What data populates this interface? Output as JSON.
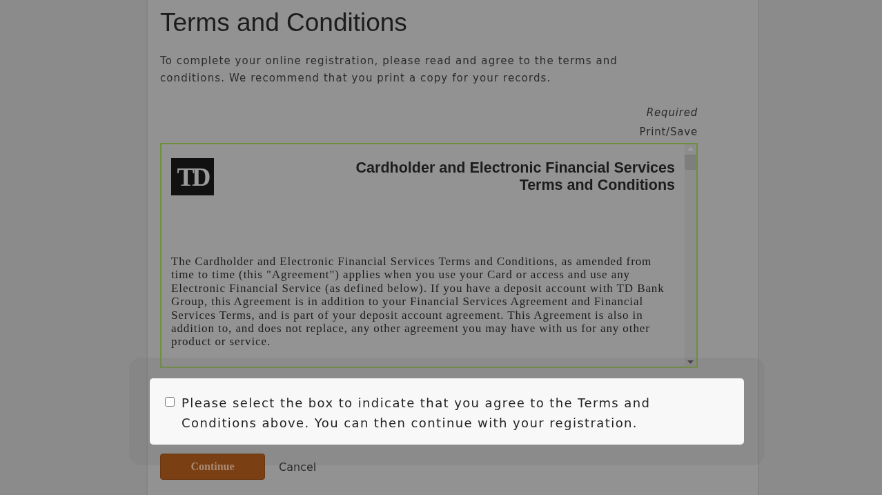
{
  "page": {
    "title": "Terms and Conditions",
    "intro": "To complete your online registration, please read and agree to the terms and conditions. We recommend that you print a copy for your records.",
    "required_note": "Required",
    "print_link": "Print/Save"
  },
  "document": {
    "logo": "TD",
    "heading_lines": [
      "Cardholder and Electronic Financial Services",
      "Terms and Conditions"
    ],
    "body": "The Cardholder and Electronic Financial Services Terms and Conditions, as amended from time to time (this \"Agreement\") applies when you use your Card or access and use any Electronic Financial Service (as defined below). If you have a deposit account with TD Bank Group, this Agreement is in addition to your Financial Services Agreement and Financial Services Terms, and is part of your deposit account agreement. This Agreement is also in addition to, and does not replace, any other agreement you may have with us for any other product or service."
  },
  "agreement": {
    "label": "Please select the box to indicate that you agree to the Terms and Conditions above. You can then continue with your registration.",
    "checked": false,
    "highlighted": true
  },
  "buttons": [
    {
      "kind": "primary",
      "label": "Continue"
    },
    {
      "kind": "link",
      "label": "Cancel"
    }
  ]
}
